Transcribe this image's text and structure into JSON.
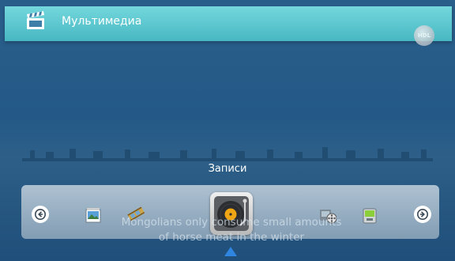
{
  "header": {
    "title": "Мультимедиа",
    "badge_text": "HDL"
  },
  "carousel": {
    "current_label": "Записи",
    "items": [
      {
        "name": "photo-item",
        "icon": "photo-icon"
      },
      {
        "name": "video-item",
        "icon": "film-icon"
      },
      {
        "name": "recordings-item",
        "icon": "turntable-icon",
        "selected": true
      },
      {
        "name": "movies-item",
        "icon": "film-reel-icon"
      },
      {
        "name": "device-item",
        "icon": "media-player-icon"
      }
    ]
  },
  "subtitle": {
    "line1": "Mongolians only consume small amounts",
    "line2": "of horse meat in the winter"
  },
  "colors": {
    "header": "#5ec8cf",
    "background": "#245987",
    "pointer": "#2f86e0"
  }
}
